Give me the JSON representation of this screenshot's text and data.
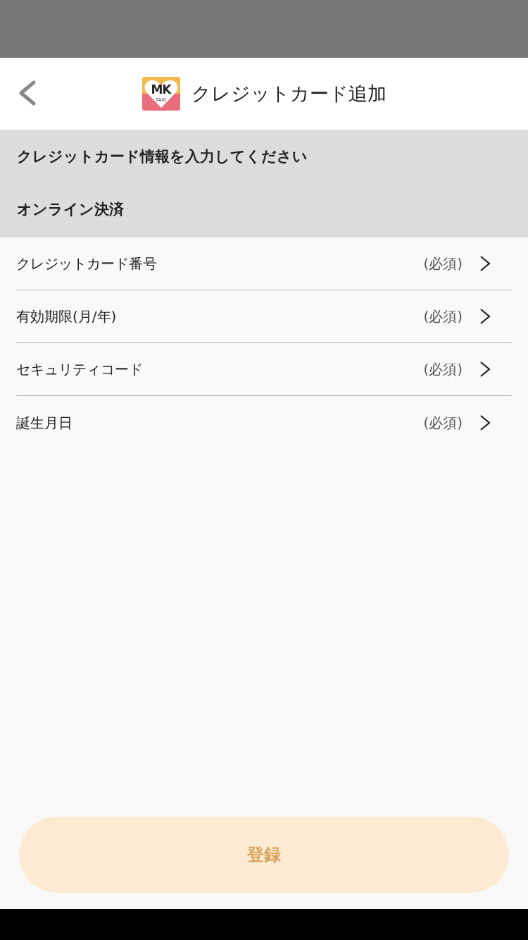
{
  "header": {
    "title": "クレジットカード追加",
    "logo": {
      "mark": "MK",
      "sub": "TAXI"
    }
  },
  "section": {
    "instruction": "クレジットカード情報を入力してください",
    "heading": "オンライン決済"
  },
  "fields": [
    {
      "label": "クレジットカード番号",
      "note": "(必須)"
    },
    {
      "label": "有効期限(月/年)",
      "note": "(必須)"
    },
    {
      "label": "セキュリティコード",
      "note": "(必須)"
    },
    {
      "label": "誕生月日",
      "note": "(必須)"
    }
  ],
  "submit": {
    "label": "登録",
    "disabled": true
  }
}
